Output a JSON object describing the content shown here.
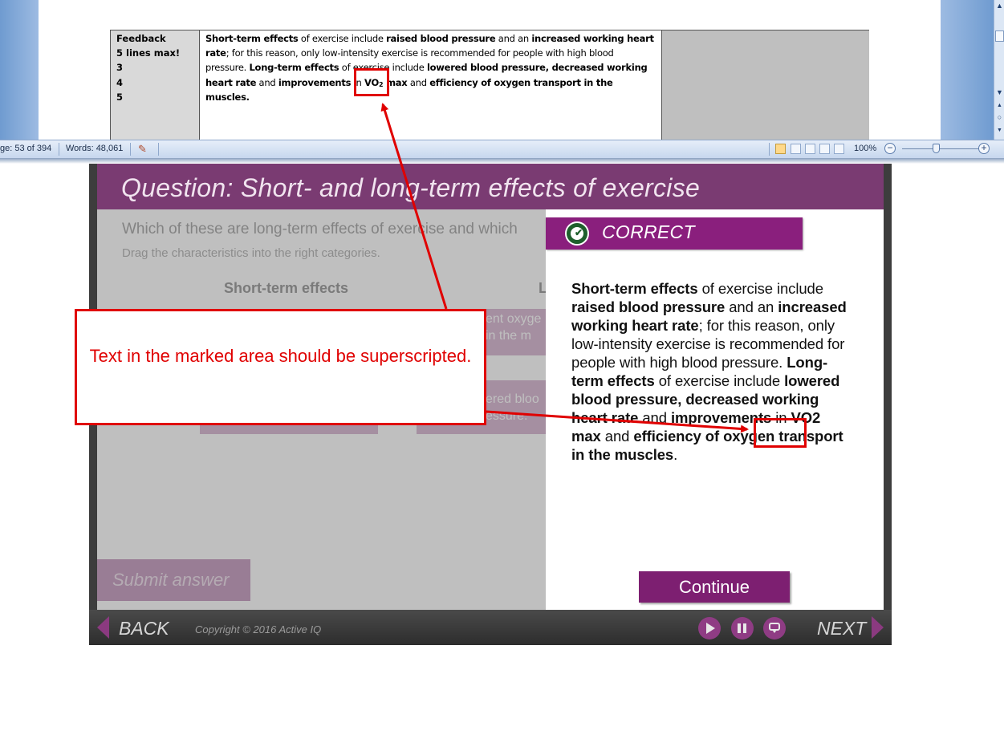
{
  "word": {
    "table": {
      "label_lines": [
        "Feedback",
        "5 lines max!",
        "3",
        "4",
        "5"
      ],
      "feedback_parts": [
        {
          "t": "Short-term effects",
          "b": true
        },
        {
          "t": " of exercise include ",
          "b": false
        },
        {
          "t": "raised blood pressure",
          "b": true
        },
        {
          "t": " and an ",
          "b": false
        },
        {
          "t": "increased working heart rate",
          "b": true
        },
        {
          "t": "; for this reason, only low-intensity exercise is recommended for people with high blood pressure. ",
          "b": false
        },
        {
          "t": "Long-term effects",
          "b": true
        },
        {
          "t": " of exercise include ",
          "b": false
        },
        {
          "t": "lowered blood pressure, decreased working heart rate",
          "b": true
        },
        {
          "t": " and ",
          "b": false
        },
        {
          "t": "improvements",
          "b": true
        },
        {
          "t": " in ",
          "b": false
        },
        {
          "t": "VO",
          "b": true
        },
        {
          "t": "2",
          "b": true,
          "sub": true
        },
        {
          "t": " max",
          "b": true
        },
        {
          "t": " and ",
          "b": false
        },
        {
          "t": "efficiency of oxygen transport in the muscles.",
          "b": true
        }
      ]
    },
    "status": {
      "page": "ge: 53 of 394",
      "words": "Words: 48,061",
      "zoom": "100%",
      "zoom_minus": "−",
      "zoom_plus": "+",
      "zoom_level": 0.5
    },
    "scroll": {
      "up": "▲",
      "down": "▼",
      "prev": "▲",
      "browse": "○",
      "next": "▼"
    }
  },
  "slide": {
    "title": "Question: Short- and long-term effects of exercise",
    "prompt": "Which of these are long-term effects of exercise and which",
    "instruction": "Drag the characteristics into the right categories.",
    "col_short": "Short-term effects",
    "col_long": "Lo",
    "pill1_lines": [
      "ent oxyge",
      "in the m"
    ],
    "pill2_lines": [
      "ered bloo",
      "essure."
    ],
    "submit": "Submit answer",
    "feedback": {
      "heading": "CORRECT",
      "check_glyph": "✔",
      "body_parts": [
        {
          "t": "Short-term effects",
          "b": true
        },
        {
          "t": " of exercise include ",
          "b": false
        },
        {
          "t": "raised blood pressure",
          "b": true
        },
        {
          "t": " and an ",
          "b": false
        },
        {
          "t": "increased working heart rate",
          "b": true
        },
        {
          "t": "; for this reason, only low-intensity exercise is recommended for people with high blood pressure. ",
          "b": false
        },
        {
          "t": "Long-term effects",
          "b": true
        },
        {
          "t": " of exercise include ",
          "b": false
        },
        {
          "t": "lowered blood pressure, decreased working heart rate",
          "b": true
        },
        {
          "t": " and ",
          "b": false
        },
        {
          "t": "improvements",
          "b": true
        },
        {
          "t": " in ",
          "b": false
        },
        {
          "t": "VO2 max",
          "b": true
        },
        {
          "t": " and ",
          "b": false
        },
        {
          "t": "efficiency of oxygen transport in the muscles",
          "b": true
        },
        {
          "t": ".",
          "b": false
        }
      ],
      "continue": "Continue"
    },
    "nav": {
      "back": "BACK",
      "next": "NEXT",
      "copyright": "Copyright © 2016 Active IQ"
    }
  },
  "annotation": {
    "text": "Text in the marked area should be superscripted.",
    "color": "#e00000"
  }
}
